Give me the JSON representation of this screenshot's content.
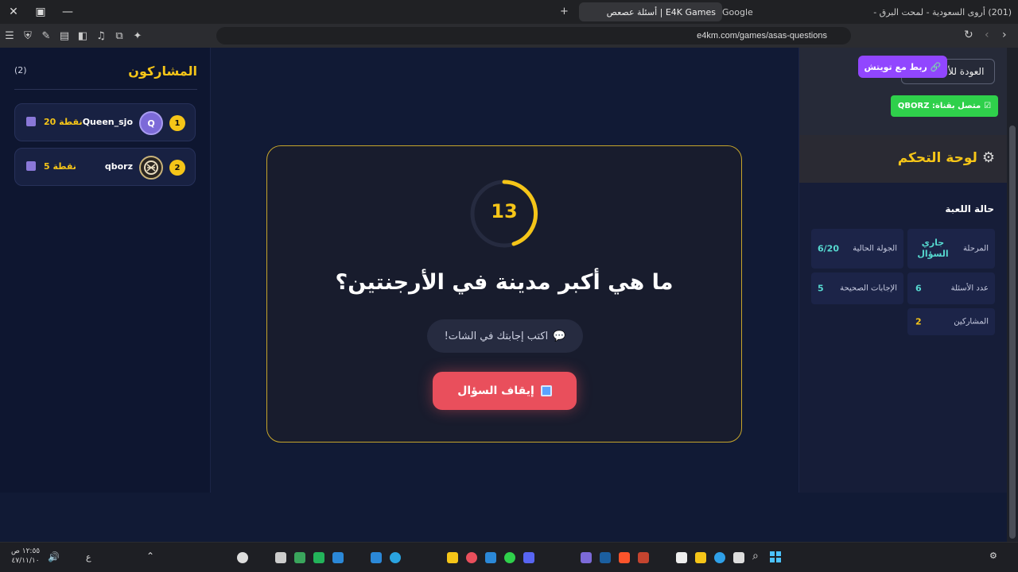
{
  "browser": {
    "tabs": [
      {
        "label": "Google"
      },
      {
        "label": "E4K Games | أسئلة عصعص"
      },
      {
        "label": "(201) أروى السعودية - لمحت البرق - ..."
      }
    ],
    "new_tab_symbol": "+",
    "url": "e4km.com/games/asas-questions"
  },
  "participants": {
    "title": "المشاركون",
    "count": "(2)",
    "list": [
      {
        "rank": "1",
        "avatar": "Q",
        "name": "Queen_sjo",
        "points": "20 نقطة"
      },
      {
        "rank": "2",
        "avatar": "",
        "name": "qborz",
        "points": "5 نقطة"
      }
    ]
  },
  "question": {
    "timer": "13",
    "text": "ما هي أكبر مدينة في الأرجنتين؟",
    "hint": "اكتب إجابتك في الشات!",
    "stop_label": "إيقاف السؤال"
  },
  "control": {
    "back_label": "العودة للألعاب",
    "twitch_label": "ربط مع تويتش",
    "connected_label": "متصل بقناة: QBORZ",
    "panel_title": "لوحة التحكم",
    "status_title": "حالة اللعبة",
    "stats": [
      {
        "label": "المرحلة",
        "value": "جاري السؤال"
      },
      {
        "label": "الجولة الحالية",
        "value": "6/20"
      },
      {
        "label": "عدد الأسئلة",
        "value": "6"
      },
      {
        "label": "الإجابات الصحيحة",
        "value": "5"
      },
      {
        "label": "المشاركين",
        "value": "2"
      }
    ]
  },
  "taskbar": {
    "time": "١٢:٥٥ ص",
    "date": "٤٧/١١/١٠",
    "lang": "ع"
  },
  "colors": {
    "accent_gold": "#f5c518",
    "stop_red": "#e94f5c",
    "twitch_purple": "#9146ff",
    "connected_green": "#2fd04b"
  }
}
